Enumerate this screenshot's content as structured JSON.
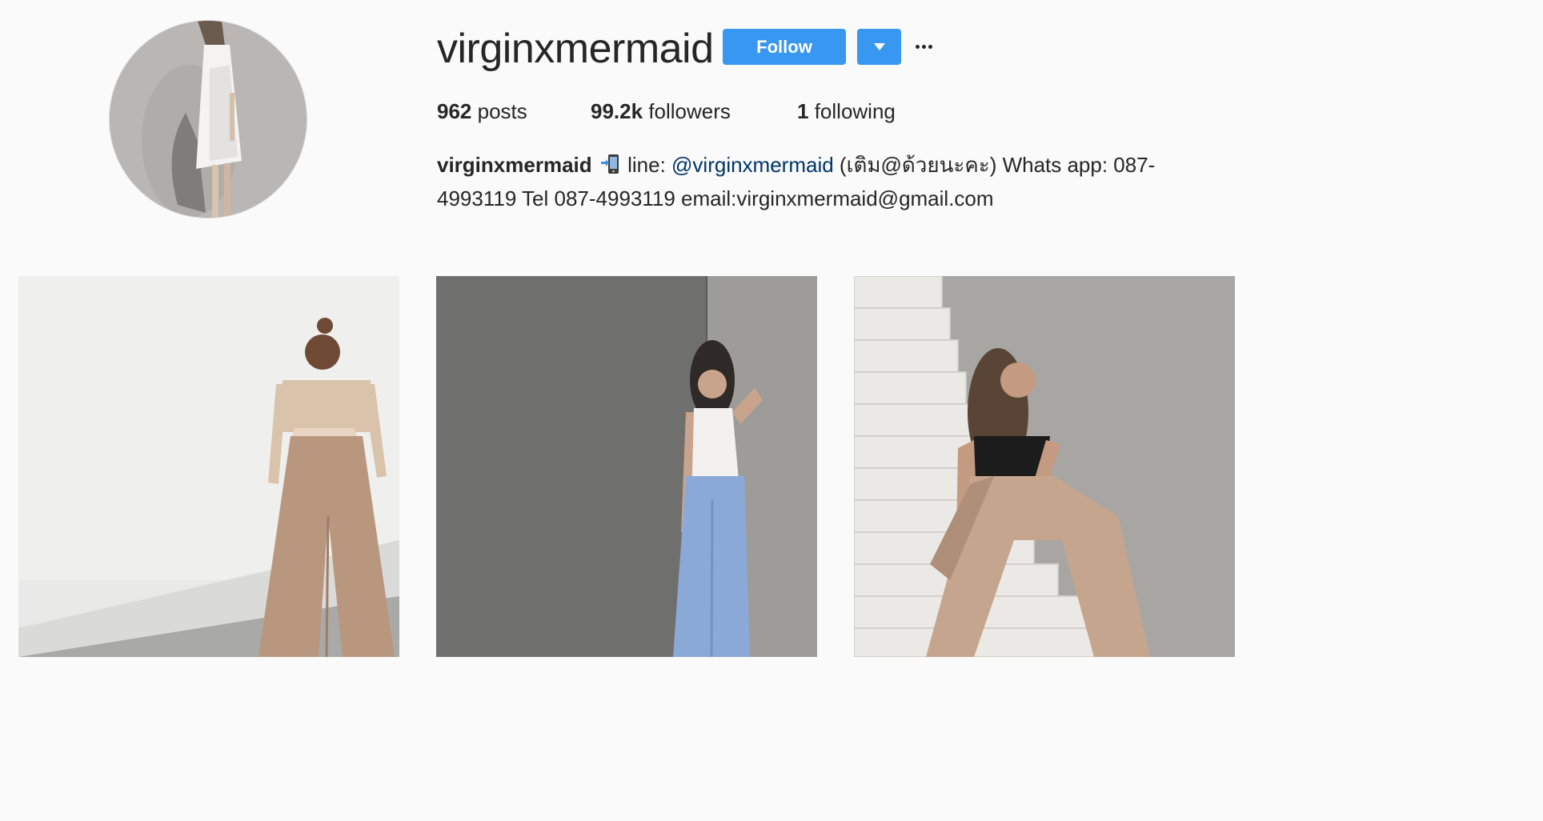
{
  "profile": {
    "username": "virginxmermaid",
    "follow_label": "Follow",
    "stats": {
      "posts_count": "962",
      "posts_label": "posts",
      "followers_count": "99.2k",
      "followers_label": "followers",
      "following_count": "1",
      "following_label": "following"
    },
    "bio": {
      "name": "virginxmermaid",
      "phone_emoji": "mobile-phone-arrow-icon",
      "line_prefix": " line: ",
      "mention": "@virginxmermaid",
      "rest_line1": " (เติม@ด้วยนะคะ) Whats app: 087-",
      "rest_line2": "4993119 Tel 087-4993119 email:virginxmermaid@gmail.com"
    }
  },
  "colors": {
    "accent": "#3897f0",
    "background": "#fafafa",
    "text": "#262626",
    "mention": "#003569"
  },
  "posts": [
    {
      "description": "Woman in beige crop top and wide-leg beige trousers against white wall"
    },
    {
      "description": "Woman in white cami and light blue striped trousers against grey wall"
    },
    {
      "description": "Woman in black cami and beige trousers sitting on marble stairs"
    }
  ]
}
